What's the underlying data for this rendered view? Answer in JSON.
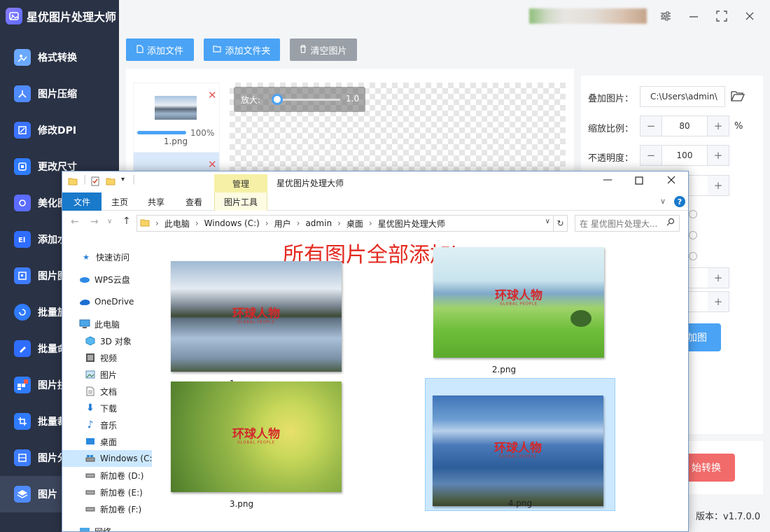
{
  "app": {
    "title": "星优图片处理大师",
    "version": "版本：v1.7.0.0"
  },
  "sidebar": {
    "items": [
      {
        "label": "格式转换",
        "color": "#6aa9ff"
      },
      {
        "label": "图片压缩",
        "color": "#4f8bff"
      },
      {
        "label": "修改DPI",
        "color": "#3b73ff"
      },
      {
        "label": "更改尺寸",
        "color": "#2f7bff"
      },
      {
        "label": "美化图",
        "color": "#5b6cff"
      },
      {
        "label": "添加水",
        "color": "#2f6dff"
      },
      {
        "label": "图片图",
        "color": "#3d7cff"
      },
      {
        "label": "批量旋",
        "color": "#2f7bff"
      },
      {
        "label": "批量命",
        "color": "#2f6dff"
      },
      {
        "label": "图片拼",
        "color": "#ff5a4a"
      },
      {
        "label": "批量裁",
        "color": "#2f7bff"
      },
      {
        "label": "图片分",
        "color": "#3d7cff"
      },
      {
        "label": "图片",
        "color": "#4f8bff"
      }
    ]
  },
  "toolbar": {
    "add_file": "添加文件",
    "add_folder": "添加文件夹",
    "clear": "清空图片"
  },
  "file_list": {
    "first_name": "1.png",
    "first_progress": "100%",
    "progress_value": 1.0
  },
  "preview": {
    "zoom_label": "放大:",
    "zoom_value": "1.0"
  },
  "settings": {
    "overlay_label": "叠加图片：",
    "overlay_path": "C:\\Users\\admin\\",
    "scale_label": "缩放比例：",
    "scale_value": "80",
    "scale_unit": "%",
    "opacity_label": "不透明度：",
    "opacity_value": "100",
    "add_image_btn": "加图",
    "start_btn": "始转换"
  },
  "explorer": {
    "title": "星优图片处理大师",
    "manage_tab": "管理",
    "tabs": {
      "file": "文件",
      "home": "主页",
      "share": "共享",
      "view": "查看",
      "picture_tools": "图片工具"
    },
    "breadcrumb": [
      "此电脑",
      "Windows (C:)",
      "用户",
      "admin",
      "桌面",
      "星优图片处理大师"
    ],
    "search_placeholder": "在 星优图片处理大...",
    "nav": [
      {
        "label": "快速访问",
        "icon": "star-icon"
      },
      {
        "label": "WPS云盘",
        "icon": "cloud-icon"
      },
      {
        "label": "OneDrive",
        "icon": "onedrive-icon"
      },
      {
        "label": "此电脑",
        "icon": "computer-icon"
      },
      {
        "label": "3D 对象",
        "icon": "cube-icon"
      },
      {
        "label": "视频",
        "icon": "video-icon"
      },
      {
        "label": "图片",
        "icon": "picture-icon"
      },
      {
        "label": "文档",
        "icon": "document-icon"
      },
      {
        "label": "下载",
        "icon": "download-icon"
      },
      {
        "label": "音乐",
        "icon": "music-icon"
      },
      {
        "label": "桌面",
        "icon": "desktop-icon"
      },
      {
        "label": "Windows (C:",
        "icon": "drive-icon"
      },
      {
        "label": "新加卷 (D:)",
        "icon": "drive-icon"
      },
      {
        "label": "新加卷 (E:)",
        "icon": "drive-icon"
      },
      {
        "label": "新加卷 (F:)",
        "icon": "drive-icon"
      },
      {
        "label": "网络",
        "icon": "network-icon"
      }
    ],
    "annotation": "所有图片全部添加logo",
    "files": [
      {
        "name": "1.png",
        "logo": "环球人物",
        "logo_sub": "GLOBAL PEOPLE"
      },
      {
        "name": "2.png",
        "logo": "环球人物",
        "logo_sub": "GLOBAL PEOPLE"
      },
      {
        "name": "3.png",
        "logo": "环球人物",
        "logo_sub": "GLOBAL PEOPLE"
      },
      {
        "name": "4.png",
        "logo": "环球人物",
        "logo_sub": "GLOBAL PEOPLE"
      }
    ]
  }
}
